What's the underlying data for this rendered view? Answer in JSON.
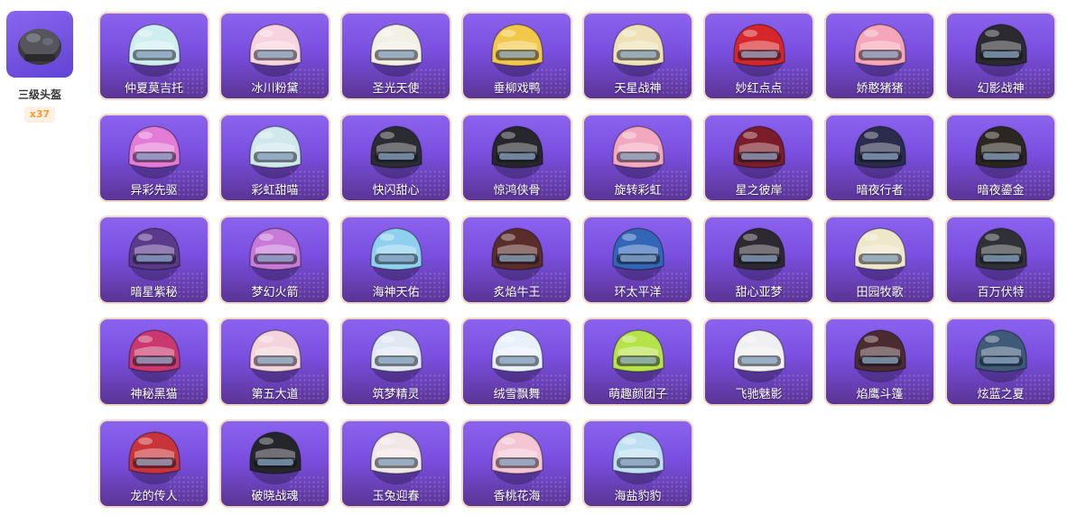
{
  "sidebar": {
    "title": "三级头盔",
    "count": "x37",
    "icon": "helmet-icon"
  },
  "accent_color": "#7a4fe0",
  "count_color": "#ff9a3c",
  "skins": [
    {
      "name": "仲夏莫吉托",
      "color": "#cfeef0"
    },
    {
      "name": "冰川粉黛",
      "color": "#f6d3de"
    },
    {
      "name": "圣光天使",
      "color": "#f2efe3"
    },
    {
      "name": "垂柳戏鸭",
      "color": "#f2c84a"
    },
    {
      "name": "天星战神",
      "color": "#efe2b8"
    },
    {
      "name": "妙红点点",
      "color": "#d7262a"
    },
    {
      "name": "娇憨猪猪",
      "color": "#f5a6b8"
    },
    {
      "name": "幻影战神",
      "color": "#2a2a30"
    },
    {
      "name": "异彩先驱",
      "color": "#e27cd6"
    },
    {
      "name": "彩虹甜喵",
      "color": "#cfe8ec"
    },
    {
      "name": "快闪甜心",
      "color": "#2b2b33"
    },
    {
      "name": "惊鸿侠骨",
      "color": "#26262c"
    },
    {
      "name": "旋转彩虹",
      "color": "#f2a9c0"
    },
    {
      "name": "星之彼岸",
      "color": "#7a1c2a"
    },
    {
      "name": "暗夜行者",
      "color": "#2a2c4c"
    },
    {
      "name": "暗夜鎏金",
      "color": "#2b2620"
    },
    {
      "name": "暗星紫秘",
      "color": "#5b3a8c"
    },
    {
      "name": "梦幻火箭",
      "color": "#c87ad9"
    },
    {
      "name": "海神天佑",
      "color": "#8fd0ee"
    },
    {
      "name": "炙焰牛王",
      "color": "#5a2d2a"
    },
    {
      "name": "环太平洋",
      "color": "#3466b8"
    },
    {
      "name": "甜心亚梦",
      "color": "#2e2830"
    },
    {
      "name": "田园牧歌",
      "color": "#efe7c9"
    },
    {
      "name": "百万伏特",
      "color": "#2f3136"
    },
    {
      "name": "神秘黑猫",
      "color": "#c9386e"
    },
    {
      "name": "第五大道",
      "color": "#f3d3dc"
    },
    {
      "name": "筑梦精灵",
      "color": "#dfe8f2"
    },
    {
      "name": "绒雪飘舞",
      "color": "#e8f1fa"
    },
    {
      "name": "萌趣颜团子",
      "color": "#b7e34a"
    },
    {
      "name": "飞驰魅影",
      "color": "#f0f0f2"
    },
    {
      "name": "焰鹰斗篷",
      "color": "#4a2b30"
    },
    {
      "name": "炫蓝之夏",
      "color": "#3e5a78"
    },
    {
      "name": "龙的传人",
      "color": "#c9343a"
    },
    {
      "name": "破晓战魂",
      "color": "#25262b"
    },
    {
      "name": "玉兔迎春",
      "color": "#f0e8e6"
    },
    {
      "name": "香桃花海",
      "color": "#f4c6d4"
    },
    {
      "name": "海盐豹豹",
      "color": "#bfdff3"
    }
  ]
}
